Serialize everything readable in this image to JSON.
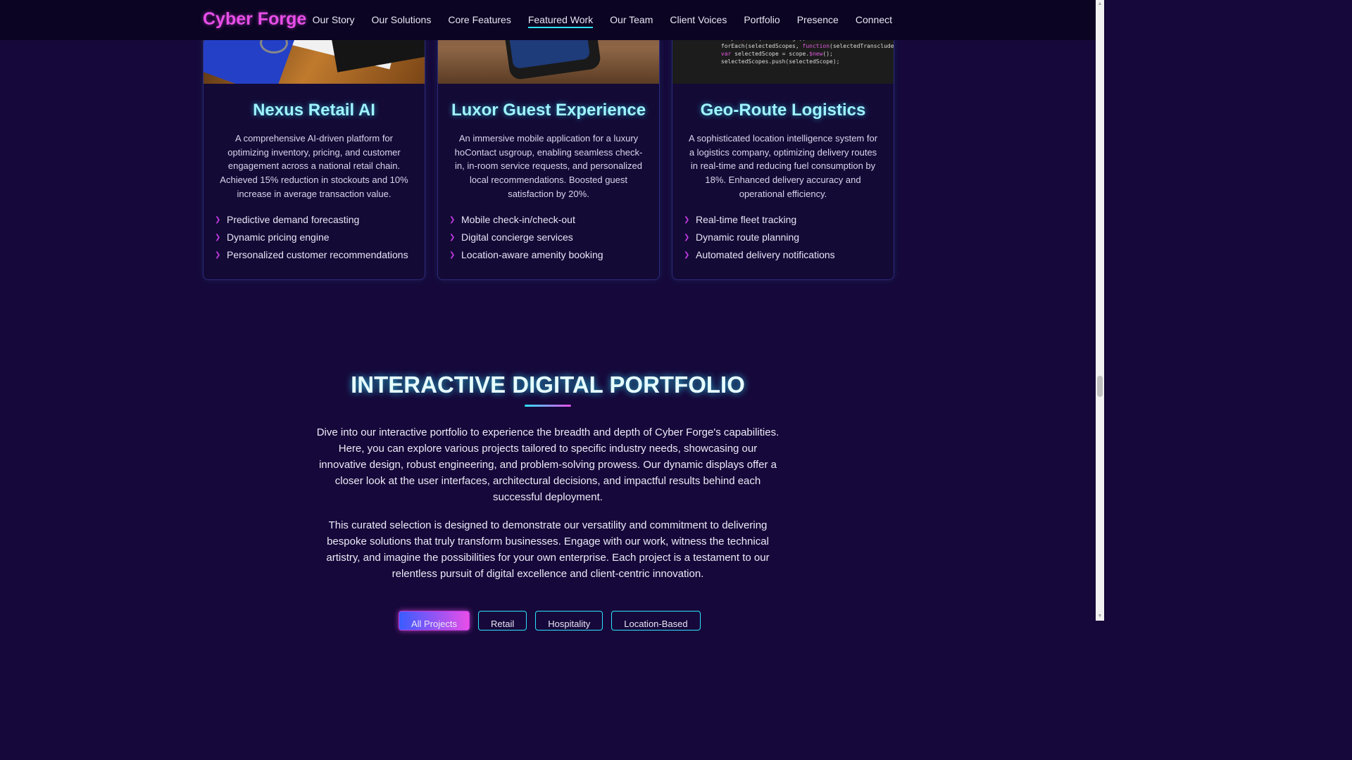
{
  "header": {
    "logo": "Cyber Forge",
    "nav": [
      "Our Story",
      "Our Solutions",
      "Core Features",
      "Featured Work",
      "Our Team",
      "Client Voices",
      "Portfolio",
      "Presence",
      "Connect"
    ],
    "active_nav": "Featured Work"
  },
  "projects": [
    {
      "title": "Nexus Retail AI",
      "description": "A comprehensive AI-driven platform for optimizing inventory, pricing, and customer engagement across a national retail chain. Achieved 15% reduction in stockouts and 10% increase in average transaction value.",
      "features": [
        "Predictive demand forecasting",
        "Dynamic pricing engine",
        "Personalized customer recommendations"
      ]
    },
    {
      "title": "Luxor Guest Experience",
      "description": "An immersive mobile application for a luxury hoContact usgroup, enabling seamless check-in, in-room service requests, and personalized local recommendations. Boosted guest satisfaction by 20%.",
      "features": [
        "Mobile check-in/check-out",
        "Digital concierge services",
        "Location-aware amenity booking"
      ]
    },
    {
      "title": "Geo-Route Logistics",
      "description": "A sophisticated location intelligence system for a logistics company, optimizing delivery routes in real-time and reducing fuel consumption by 18%. Enhanced delivery accuracy and operational efficiency.",
      "features": [
        "Real-time fleet tracking",
        "Dynamic route planning",
        "Automated delivery notifications"
      ]
    }
  ],
  "portfolio": {
    "title": "INTERACTIVE DIGITAL PORTFOLIO",
    "paragraph1": "Dive into our interactive portfolio to experience the breadth and depth of Cyber Forge's capabilities. Here, you can explore various projects tailored to specific industry needs, showcasing our innovative design, robust engineering, and problem-solving prowess. Our dynamic displays offer a closer look at the user interfaces, architectural decisions, and impactful results behind each successful deployment.",
    "paragraph2": "This curated selection is designed to demonstrate our versatility and commitment to delivering bespoke solutions that truly transform businesses. Engage with our work, witness the technical artistry, and imagine the possibilities for your own enterprise. Each project is a testament to our relentless pursuit of digital excellence and client-centric innovation.",
    "filters": [
      "All Projects",
      "Retail",
      "Hospitality",
      "Location-Based"
    ],
    "active_filter": "All Projects"
  },
  "colors": {
    "background": "#16083a",
    "accent_cyan": "#2de2ff",
    "accent_magenta": "#e84ee8"
  }
}
